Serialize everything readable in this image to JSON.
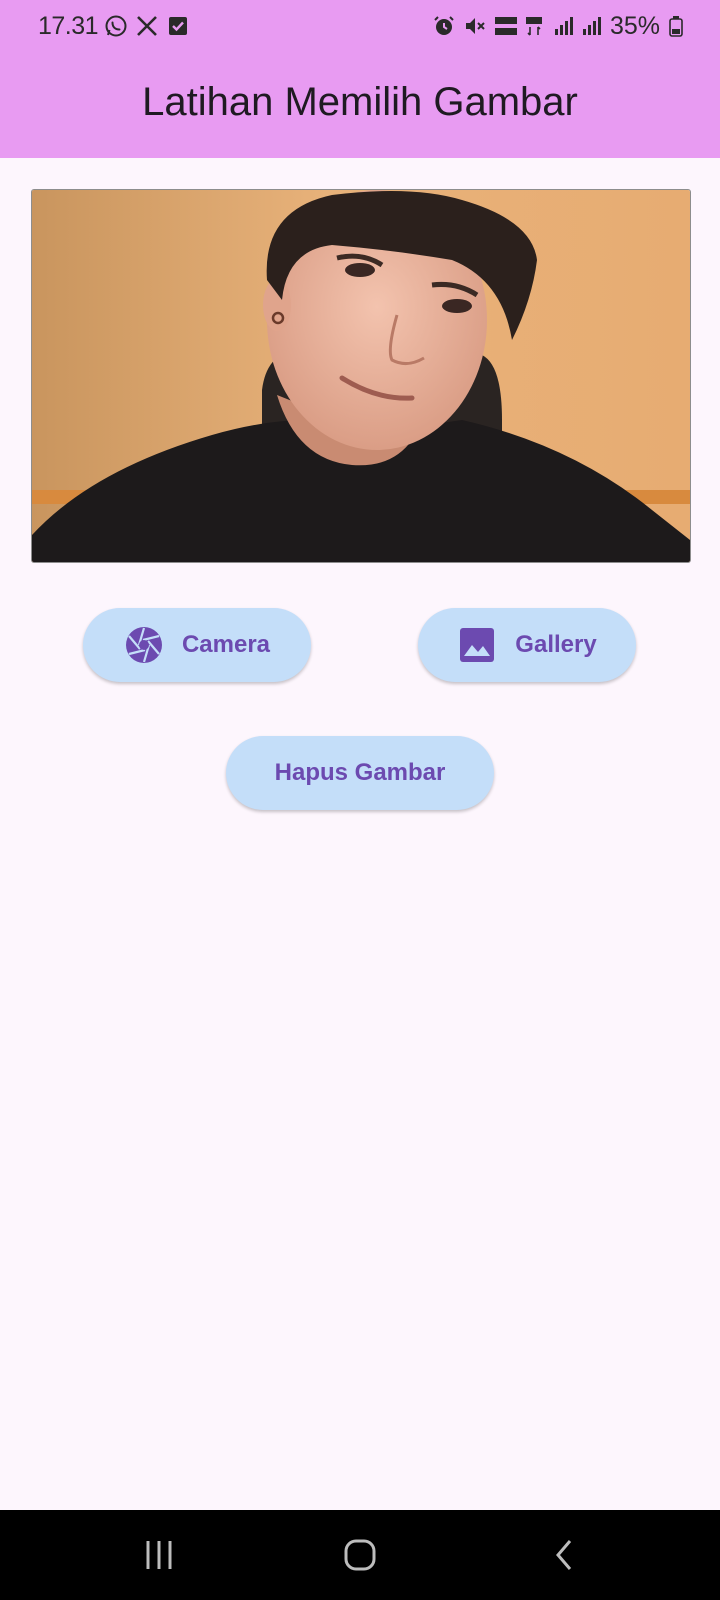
{
  "status_bar": {
    "time": "17.31",
    "battery_percent": "35%",
    "icons_left": [
      "whatsapp-icon",
      "x-icon",
      "check-box-icon"
    ],
    "icons_right": [
      "alarm-icon",
      "mute-icon",
      "volte-lte1-icon",
      "4g-plus-icon",
      "signal-icon",
      "signal-icon",
      "battery-icon"
    ]
  },
  "app_bar": {
    "title": "Latihan Memilih Gambar",
    "color": "#e89bf2"
  },
  "image": {
    "description_icon": "photo"
  },
  "buttons": {
    "camera": {
      "label": "Camera",
      "icon": "camera-shutter-icon"
    },
    "gallery": {
      "label": "Gallery",
      "icon": "image-icon"
    },
    "delete": {
      "label": "Hapus Gambar"
    }
  },
  "colors": {
    "button_bg": "#c4def9",
    "button_fg": "#6c4ab0",
    "background": "#fdf6fd"
  },
  "nav_bar": {
    "buttons": [
      "recent-apps-icon",
      "home-icon",
      "back-icon"
    ]
  }
}
